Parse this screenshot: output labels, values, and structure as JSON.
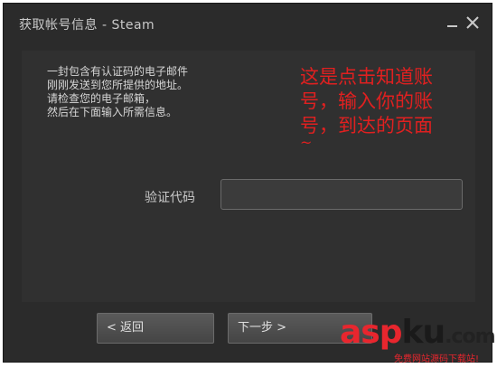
{
  "window": {
    "title": "获取帐号信息 - Steam",
    "minimize_label": "_",
    "close_label": "✕"
  },
  "instructions": {
    "line1": "一封包含有认证码的电子邮件",
    "line2": "刚刚发送到您所提供的地址。",
    "line3": "请检查您的电子邮箱，",
    "line4": "然后在下面输入所需信息。"
  },
  "annotation": {
    "line1": "这是点击知道账",
    "line2": "号，输入你的账",
    "line3": "号，到达的页面",
    "line4": "~",
    "color": "#e02020"
  },
  "form": {
    "code_label": "验证代码",
    "code_value": ""
  },
  "buttons": {
    "back_label": "< 返回",
    "next_label": "下一步 >"
  },
  "watermark": {
    "logo_part1": "asp",
    "logo_part2": "ku",
    "logo_part3": ".com",
    "subtitle": "免费网站源码下载站!"
  }
}
